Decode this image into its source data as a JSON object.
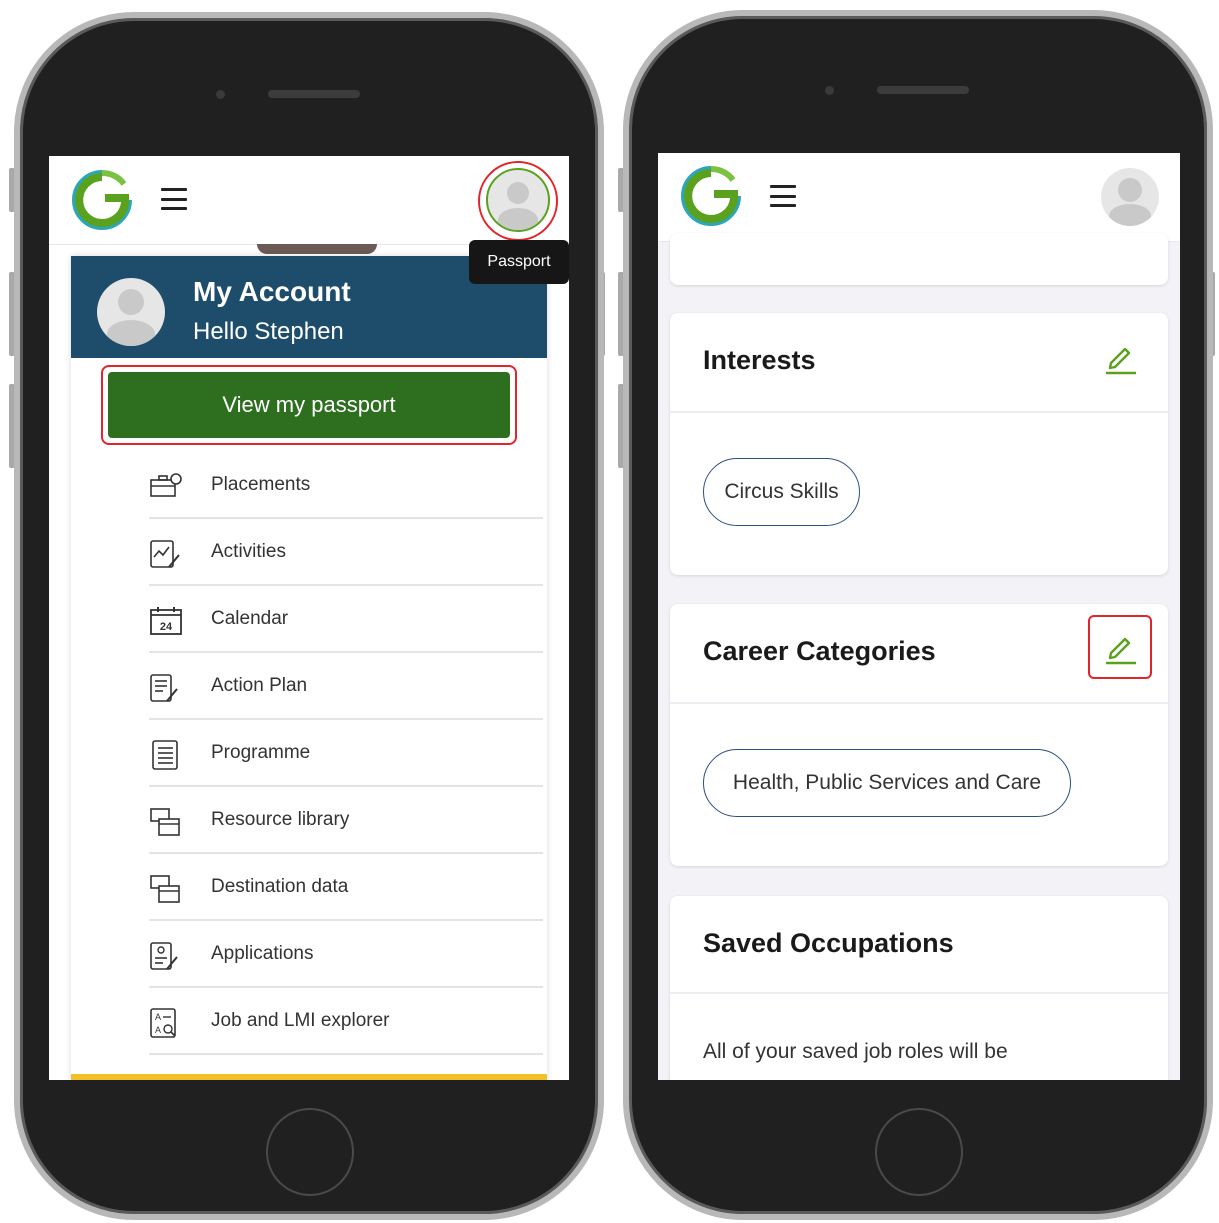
{
  "left_phone": {
    "tooltip": "Passport",
    "account": {
      "title": "My Account",
      "greeting": "Hello Stephen"
    },
    "passport_button": "View my passport",
    "menu": [
      {
        "label": "Placements",
        "icon": "placements-icon"
      },
      {
        "label": "Activities",
        "icon": "activities-icon"
      },
      {
        "label": "Calendar",
        "icon": "calendar-icon",
        "calendar_day": "24"
      },
      {
        "label": "Action Plan",
        "icon": "action-plan-icon"
      },
      {
        "label": "Programme",
        "icon": "programme-icon"
      },
      {
        "label": "Resource library",
        "icon": "resource-library-icon"
      },
      {
        "label": "Destination data",
        "icon": "destination-data-icon"
      },
      {
        "label": "Applications",
        "icon": "applications-icon"
      },
      {
        "label": "Job and LMI explorer",
        "icon": "job-explorer-icon"
      }
    ]
  },
  "right_phone": {
    "interests": {
      "title": "Interests",
      "chips": [
        "Circus Skills"
      ]
    },
    "career_categories": {
      "title": "Career Categories",
      "chips": [
        "Health, Public Services and Care"
      ]
    },
    "saved_occupations": {
      "title": "Saved Occupations",
      "body": "All of your saved job roles will be"
    }
  },
  "colors": {
    "brand_green": "#2d6e1f",
    "account_header": "#1e4d6b",
    "highlight": "#e0262b",
    "chip_border": "#2c4f82",
    "edit_icon": "#5aa11e"
  }
}
